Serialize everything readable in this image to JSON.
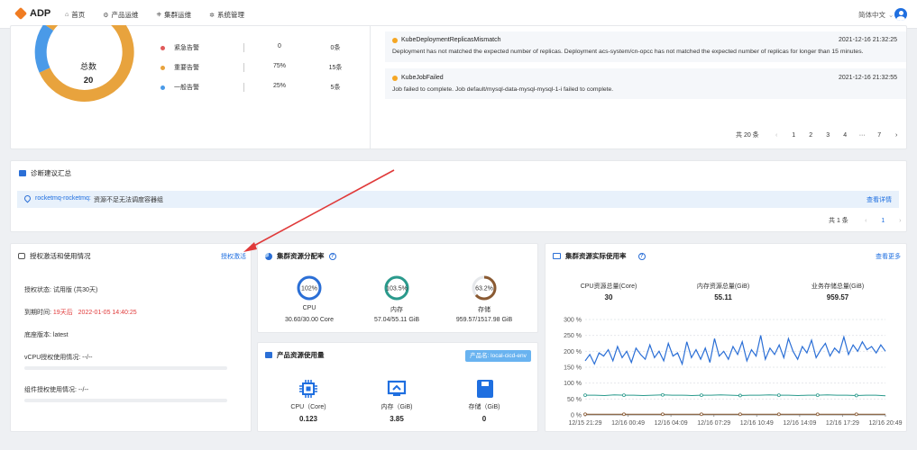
{
  "topbar": {
    "logo": "ADP",
    "nav": [
      {
        "label": "首页",
        "icon": "home-icon",
        "glyph": "⌂"
      },
      {
        "label": "产品运维",
        "icon": "gear-icon",
        "glyph": "⚙"
      },
      {
        "label": "集群运维",
        "icon": "cluster-icon",
        "glyph": "⎈"
      },
      {
        "label": "系统管理",
        "icon": "settings-icon",
        "glyph": "✲"
      }
    ],
    "language": "简体中文",
    "language_chevron": "⌄"
  },
  "alarm_summary": {
    "donut_label": "总数",
    "donut_total": "20",
    "legend": [
      {
        "name": "紧急告警",
        "percent": "0",
        "count": "0条",
        "color": "#e05a5a"
      },
      {
        "name": "重要告警",
        "percent": "75%",
        "count": "15条",
        "color": "#e8a33d"
      },
      {
        "name": "一般告警",
        "percent": "25%",
        "count": "5条",
        "color": "#4a9ae8"
      }
    ],
    "donut_colors": {
      "important": "#e8a33d",
      "normal": "#4a9ae8"
    }
  },
  "alerts": [
    {
      "name": "KubeDeploymentReplicasMismatch",
      "time": "2021-12-16 21:32:25",
      "desc": "Deployment has not matched the expected number of replicas. Deployment acs-system/cn-opcc has not matched the expected number of replicas for longer than 15 minutes."
    },
    {
      "name": "KubeJobFailed",
      "time": "2021-12-16 21:32:55",
      "desc": "Job failed to complete. Job default/mysql-data-mysql-mysql-1-i failed to complete."
    }
  ],
  "alert_pager": {
    "total": "共 20 条",
    "pages": [
      "1",
      "2",
      "3",
      "4",
      "···",
      "7"
    ],
    "prev": "‹",
    "next": "›"
  },
  "diagnosis": {
    "title": "诊断建议汇总",
    "item_source": "rocketmq-rocketmq:",
    "item_text": "资源不足无法调度容器组",
    "detail_link": "查看详情",
    "pager": {
      "total": "共 1 条",
      "pages": [
        "1"
      ],
      "prev": "‹",
      "next": "›"
    }
  },
  "license": {
    "title": "授权激活和使用情况",
    "activate_link": "授权激活",
    "status_label": "授权状态: 试用版 (共30天)",
    "expire_label": "到期时间:",
    "expire_days": "19天后",
    "expire_date": "2022-01-05 14:40:25",
    "base_version": "底座版本: latest",
    "vcpu_usage": "vCPU授权使用情况: --/--",
    "component_usage": "组件授权使用情况: --/--"
  },
  "cluster_alloc": {
    "title": "集群资源分配率",
    "gauges": [
      {
        "label": "CPU",
        "percent": "102%",
        "fraction": 1.0,
        "value": "30.60/30.00 Core",
        "color": "#2b6fd6"
      },
      {
        "label": "内存",
        "percent": "103.5%",
        "fraction": 1.0,
        "value": "57.04/55.11 GiB",
        "color": "#2a9a8c"
      },
      {
        "label": "存储",
        "percent": "63.2%",
        "fraction": 0.632,
        "value": "959.57/1517.98 GiB",
        "color": "#8a5a32"
      }
    ]
  },
  "product_usage": {
    "title": "产品资源使用量",
    "product_tag": "产品名: local-cicd-env",
    "items": [
      {
        "label": "CPU（Core)",
        "value": "0.123",
        "icon": "cpu-icon"
      },
      {
        "label": "内存（GiB)",
        "value": "3.85",
        "icon": "memory-icon"
      },
      {
        "label": "存储（GiB)",
        "value": "0",
        "icon": "storage-icon"
      }
    ]
  },
  "cluster_actual": {
    "title": "集群资源实际使用率",
    "more_link": "查看更多",
    "stats": [
      {
        "label": "CPU资源总量(Core)",
        "value": "30"
      },
      {
        "label": "内存资源总量(GiB)",
        "value": "55.11"
      },
      {
        "label": "业务存储总量(GiB)",
        "value": "959.57"
      }
    ]
  },
  "chart_data": {
    "type": "line",
    "title": "",
    "xlabel": "",
    "ylabel": "",
    "ylim": [
      0,
      300
    ],
    "yticks": [
      "0 %",
      "50 %",
      "100 %",
      "150 %",
      "200 %",
      "250 %",
      "300 %"
    ],
    "xticks": [
      "12/15 21:29",
      "12/16 00:49",
      "12/16 04:09",
      "12/16 07:29",
      "12/16 10:49",
      "12/16 14:09",
      "12/16 17:29",
      "12/16 20:49"
    ],
    "grid": true,
    "series": [
      {
        "color": "#2b6fd6",
        "values": [
          170,
          190,
          160,
          195,
          185,
          205,
          170,
          215,
          180,
          200,
          165,
          210,
          190,
          175,
          220,
          180,
          200,
          170,
          225,
          185,
          195,
          160,
          230,
          180,
          205,
          175,
          210,
          165,
          240,
          185,
          200,
          175,
          215,
          190,
          230,
          170,
          205,
          185,
          250,
          175,
          210,
          190,
          220,
          180,
          240,
          200,
          175,
          215,
          195,
          235,
          180,
          205,
          225,
          185,
          210,
          195,
          245,
          190,
          220,
          200,
          230,
          205,
          215,
          195,
          220,
          200
        ]
      },
      {
        "color": "#2a9a8c",
        "values": [
          62,
          62,
          61,
          63,
          62,
          62,
          61,
          62,
          63,
          62,
          62,
          61,
          62,
          62,
          63,
          62,
          61,
          62,
          62,
          63,
          62,
          62,
          61,
          62,
          62,
          63,
          62,
          62,
          61,
          62,
          62,
          60
        ]
      },
      {
        "color": "#8a5a32",
        "values": [
          2,
          2,
          2,
          2,
          2,
          2,
          2,
          2,
          2,
          2,
          2,
          2,
          2,
          2,
          2,
          2,
          2,
          2,
          2,
          2,
          2,
          2,
          2,
          2,
          2,
          2,
          2,
          2,
          2,
          2,
          2,
          2
        ]
      }
    ]
  },
  "annotation": {
    "arrow_color": "#e03a3a"
  }
}
